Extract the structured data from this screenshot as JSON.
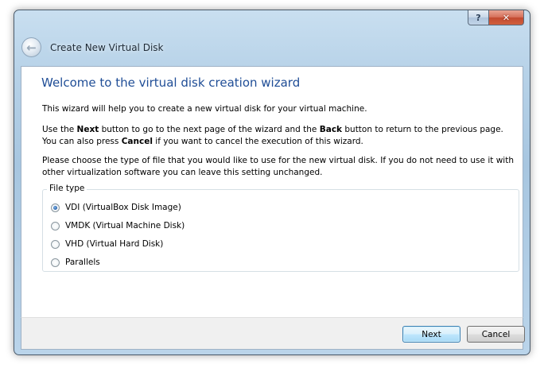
{
  "window": {
    "title": "Create New Virtual Disk",
    "help_glyph": "?",
    "close_glyph": "✕",
    "back_glyph": "←"
  },
  "page": {
    "title": "Welcome to the virtual disk creation wizard",
    "intro": "This wizard will help you to create a new virtual disk for your virtual machine.",
    "nav_help": {
      "t1": "Use the ",
      "next": "Next",
      "t2": " button to go to the next page of the wizard and the ",
      "back": "Back",
      "t3": " button to return to the previous page. You can also press ",
      "cancel": "Cancel",
      "t4": " if you want to cancel the execution of this wizard."
    },
    "choose_text": "Please choose the type of file that you would like to use for the new virtual disk. If you do not need to use it with other virtualization software you can leave this setting unchanged."
  },
  "file_type": {
    "label": "File type",
    "selected": "VDI (VirtualBox Disk Image)",
    "options": [
      {
        "label": "VDI (VirtualBox Disk Image)"
      },
      {
        "label": "VMDK (Virtual Machine Disk)"
      },
      {
        "label": "VHD (Virtual Hard Disk)"
      },
      {
        "label": "Parallels"
      }
    ]
  },
  "buttons": {
    "next": "Next",
    "cancel": "Cancel"
  },
  "colors": {
    "title_blue": "#1f4d96",
    "default_button_border": "#3c7fb1"
  }
}
